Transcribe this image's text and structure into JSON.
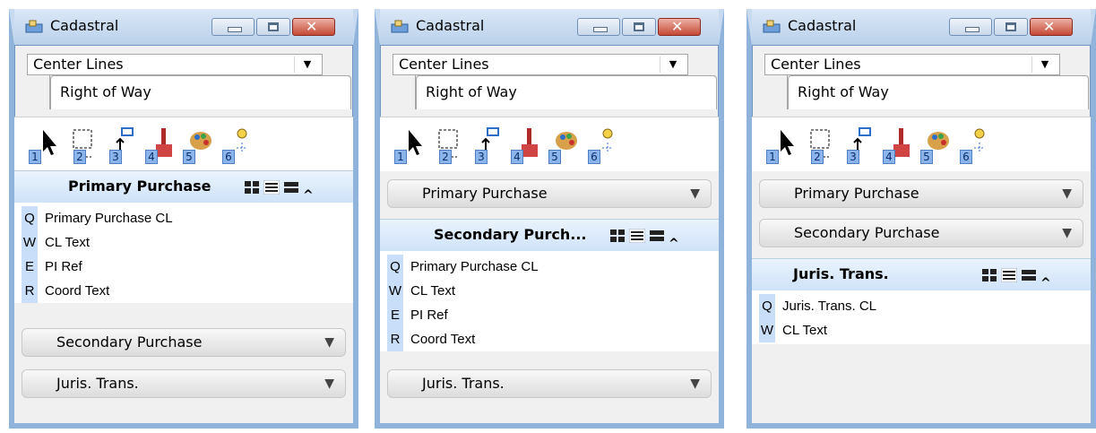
{
  "windows": [
    {
      "title": "Cadastral",
      "combo_value": "Center Lines",
      "tab_label": "Right of Way",
      "tools": [
        "1",
        "2",
        "3",
        "4",
        "5",
        "6"
      ],
      "sections": [
        {
          "label": "Primary Purchase",
          "open": true,
          "items": [
            {
              "key": "Q",
              "label": "Primary Purchase CL"
            },
            {
              "key": "W",
              "label": "CL Text"
            },
            {
              "key": "E",
              "label": "PI Ref"
            },
            {
              "key": "R",
              "label": "Coord Text"
            }
          ]
        },
        {
          "label": "Secondary Purchase",
          "open": false
        },
        {
          "label": "Juris. Trans.",
          "open": false
        }
      ]
    },
    {
      "title": "Cadastral",
      "combo_value": "Center Lines",
      "tab_label": "Right of Way",
      "tools": [
        "1",
        "2",
        "3",
        "4",
        "5",
        "6"
      ],
      "sections": [
        {
          "label": "Primary Purchase",
          "open": false
        },
        {
          "label": "Secondary Purch...",
          "open": true,
          "items": [
            {
              "key": "Q",
              "label": "Primary Purchase CL"
            },
            {
              "key": "W",
              "label": "CL Text"
            },
            {
              "key": "E",
              "label": "PI Ref"
            },
            {
              "key": "R",
              "label": "Coord Text"
            }
          ]
        },
        {
          "label": "Juris. Trans.",
          "open": false
        }
      ]
    },
    {
      "title": "Cadastral",
      "combo_value": "Center Lines",
      "tab_label": "Right of Way",
      "tools": [
        "1",
        "2",
        "3",
        "4",
        "5",
        "6"
      ],
      "sections": [
        {
          "label": "Primary Purchase",
          "open": false
        },
        {
          "label": "Secondary Purchase",
          "open": false
        },
        {
          "label": "Juris. Trans.",
          "open": true,
          "items": [
            {
              "key": "Q",
              "label": "Juris. Trans. CL"
            },
            {
              "key": "W",
              "label": "CL Text"
            }
          ]
        }
      ]
    }
  ]
}
